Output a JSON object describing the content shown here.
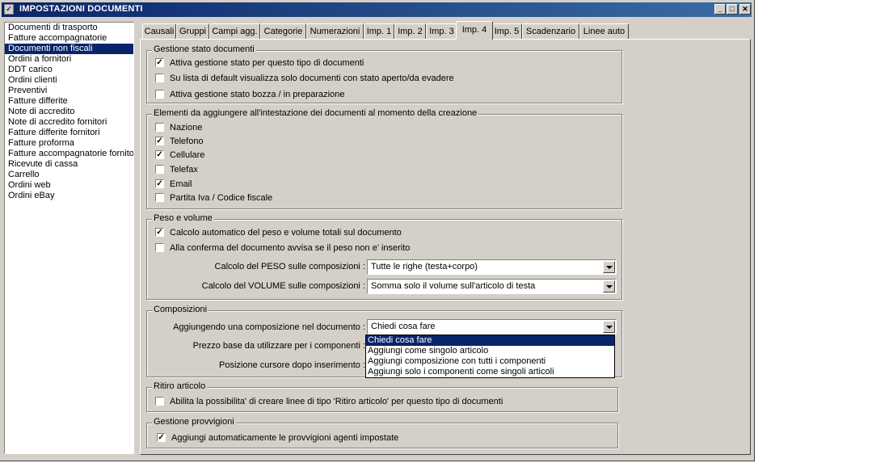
{
  "window": {
    "title": "IMPOSTAZIONI DOCUMENTI",
    "buttons": {
      "minimize": "_",
      "maximize": "□",
      "close": "✕"
    }
  },
  "doc_types": [
    "Documenti di trasporto",
    "Fatture accompagnatorie",
    "Documenti non fiscali",
    "Ordini a fornitori",
    "DDT carico",
    "Ordini clienti",
    "Preventivi",
    "Fatture differite",
    "Note di accredito",
    "Note di accredito fornitori",
    "Fatture differite fornitori",
    "Fatture proforma",
    "Fatture accompagnatorie fornitori",
    "Ricevute di cassa",
    "Carrello",
    "Ordini web",
    "Ordini eBay"
  ],
  "selected_doc_type": "Documenti non fiscali",
  "tabs": [
    "Causali",
    "Gruppi",
    "Campi agg.",
    "Categorie",
    "Numerazioni",
    "Imp. 1",
    "Imp. 2",
    "Imp. 3",
    "Imp. 4",
    "Imp. 5",
    "Scadenzario",
    "Linee auto"
  ],
  "active_tab": "Imp. 4",
  "groups": {
    "stato": {
      "title": "Gestione stato documenti",
      "items": [
        {
          "label": "Attiva gestione stato per questo tipo di documenti",
          "checked": "✓"
        },
        {
          "label": "Su lista di default visualizza solo documenti con stato aperto/da evadere",
          "checked": ""
        },
        {
          "label": "Attiva gestione stato bozza / in preparazione",
          "checked": ""
        }
      ]
    },
    "intestazione": {
      "title": "Elementi da aggiungere all'intestazione dei documenti al momento della creazione",
      "items": [
        {
          "label": "Nazione",
          "checked": ""
        },
        {
          "label": "Telefono",
          "checked": "✓"
        },
        {
          "label": "Cellulare",
          "checked": "✓"
        },
        {
          "label": "Telefax",
          "checked": ""
        },
        {
          "label": "Email",
          "checked": "✓"
        },
        {
          "label": "Partita Iva / Codice fiscale",
          "checked": ""
        }
      ]
    },
    "peso": {
      "title": "Peso e volume",
      "items": [
        {
          "label": "Calcolo automatico del peso e volume totali sul documento",
          "checked": "✓"
        },
        {
          "label": "Alla conferma del documento avvisa se il peso non e' inserito",
          "checked": ""
        }
      ],
      "peso_label": "Calcolo del PESO sulle composizioni :",
      "peso_value": "Tutte le righe (testa+corpo)",
      "volume_label": "Calcolo del VOLUME sulle composizioni :",
      "volume_value": "Somma solo il volume sull'articolo di testa"
    },
    "composizioni": {
      "title": "Composizioni",
      "aggiungendo_label": "Aggiungendo una composizione nel documento :",
      "aggiungendo_value": "Chiedi cosa fare",
      "prezzo_label": "Prezzo base da utilizzare per i componenti :",
      "cursore_label": "Posizione cursore dopo inserimento :",
      "dropdown_options": [
        "Chiedi cosa fare",
        "Aggiungi come singolo articolo",
        "Aggiungi composizione con tutti i componenti",
        "Aggiungi solo i componenti come singoli articoli"
      ]
    },
    "ritiro": {
      "title": "Ritiro articolo",
      "items": [
        {
          "label": "Abilita la possibilita' di creare linee di tipo 'Ritiro articolo' per questo tipo di documenti",
          "checked": ""
        }
      ]
    },
    "provvigioni": {
      "title": "Gestione provvigioni",
      "items": [
        {
          "label": "Aggiungi automaticamente le provvigioni agenti impostate",
          "checked": "✓"
        }
      ]
    }
  },
  "colors": {
    "face": "#d4d0c8",
    "selection": "#0a246a",
    "title_start": "#0a246a",
    "title_end": "#3a6ea5"
  }
}
